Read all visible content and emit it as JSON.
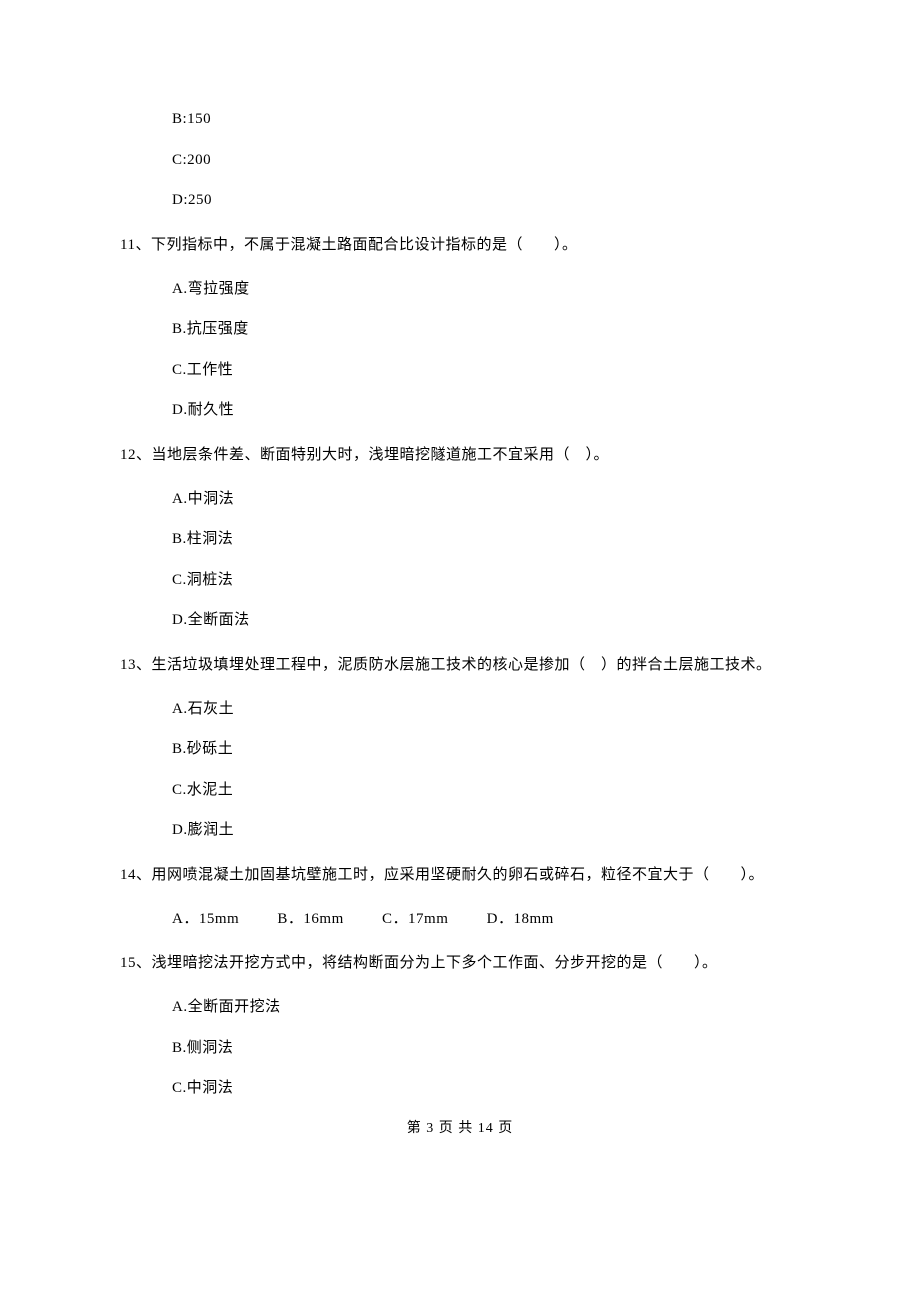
{
  "q10": {
    "optB": "B:150",
    "optC": "C:200",
    "optD": "D:250"
  },
  "q11": {
    "stem": "11、下列指标中，不属于混凝土路面配合比设计指标的是（　　）。",
    "optA": "A.弯拉强度",
    "optB": "B.抗压强度",
    "optC": "C.工作性",
    "optD": "D.耐久性"
  },
  "q12": {
    "stem": "12、当地层条件差、断面特别大时，浅埋暗挖隧道施工不宜采用（　）。",
    "optA": "A.中洞法",
    "optB": "B.柱洞法",
    "optC": "C.洞桩法",
    "optD": "D.全断面法"
  },
  "q13": {
    "stem": "13、生活垃圾填埋处理工程中，泥质防水层施工技术的核心是掺加（　）的拌合土层施工技术。",
    "optA": "A.石灰土",
    "optB": "B.砂砾土",
    "optC": "C.水泥土",
    "optD": "D.膨润土"
  },
  "q14": {
    "stem": "14、用网喷混凝土加固基坑壁施工时，应采用坚硬耐久的卵石或碎石，粒径不宜大于（　　）。",
    "optA": "A．15mm",
    "optB": "B．16mm",
    "optC": "C．17mm",
    "optD": "D．18mm"
  },
  "q15": {
    "stem": "15、浅埋暗挖法开挖方式中，将结构断面分为上下多个工作面、分步开挖的是（　　）。",
    "optA": "A.全断面开挖法",
    "optB": "B.侧洞法",
    "optC": "C.中洞法"
  },
  "footer": "第 3 页 共 14 页"
}
